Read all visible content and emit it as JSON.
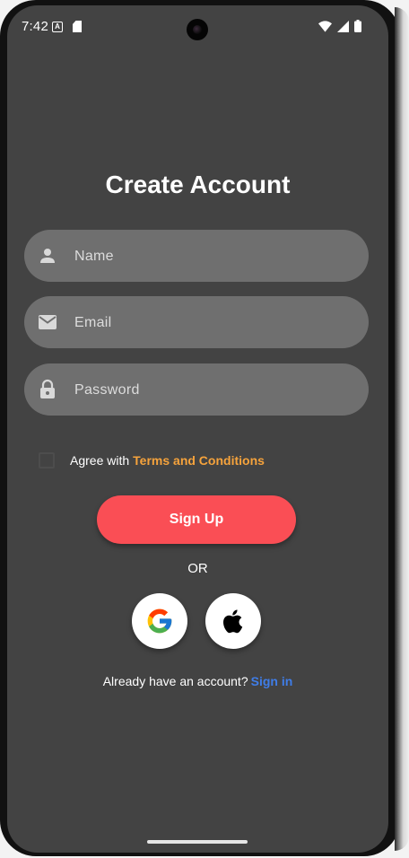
{
  "status_bar": {
    "time": "7:42",
    "icons": [
      "a-notification-icon",
      "sd-card-icon",
      "wifi-icon",
      "signal-icon",
      "battery-icon"
    ]
  },
  "title": "Create Account",
  "fields": {
    "name": {
      "placeholder": "Name",
      "icon": "person-icon"
    },
    "email": {
      "placeholder": "Email",
      "icon": "mail-icon"
    },
    "password": {
      "placeholder": "Password",
      "icon": "lock-icon"
    }
  },
  "terms": {
    "prefix": "Agree with",
    "link": "Terms and Conditions",
    "checked": false
  },
  "signup_button": "Sign Up",
  "divider": "OR",
  "social": [
    "google-icon",
    "apple-icon"
  ],
  "signin": {
    "prompt": "Already have an account?",
    "link": "Sign in"
  },
  "colors": {
    "background": "#434343",
    "field": "#6f6f6f",
    "accent": "#fa4e55",
    "terms_link": "#f6a33c",
    "signin_link": "#3f7de8"
  }
}
